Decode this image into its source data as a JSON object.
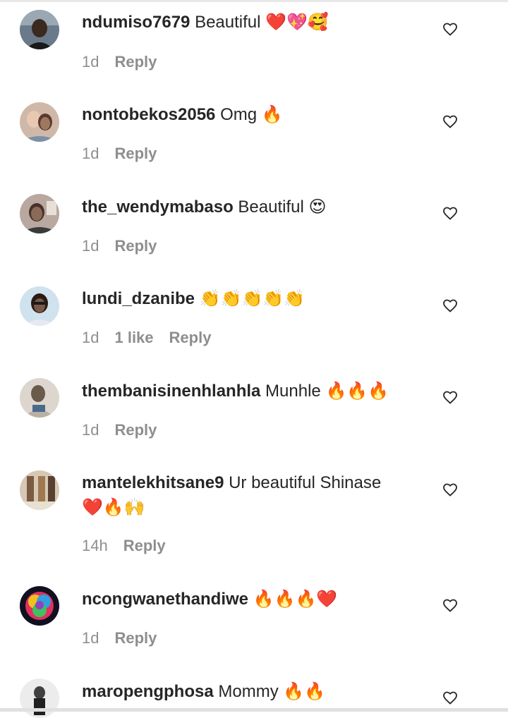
{
  "comments": [
    {
      "username": "ndumiso7679",
      "text": "Beautiful",
      "emoji": "❤️💖🥰",
      "time": "1d",
      "likes": "",
      "reply": "Reply",
      "avatar_icon": "avatar-photo",
      "avatar_colors": [
        "#5a6a7a",
        "#2a2a2a"
      ]
    },
    {
      "username": "nontobekos2056",
      "text": "Omg",
      "emoji": "🔥",
      "time": "1d",
      "likes": "",
      "reply": "Reply",
      "avatar_icon": "avatar-photo",
      "avatar_colors": [
        "#d9b8a0",
        "#3a2a2a"
      ]
    },
    {
      "username": "the_wendymabaso",
      "text": "Beautiful",
      "emoji": "😍",
      "time": "1d",
      "likes": "",
      "reply": "Reply",
      "avatar_icon": "avatar-photo",
      "avatar_colors": [
        "#c8b0a0",
        "#4a3a3a"
      ]
    },
    {
      "username": "lundi_dzanibe",
      "text": "",
      "emoji": "👏👏👏👏👏",
      "time": "1d",
      "likes": "1 like",
      "reply": "Reply",
      "avatar_icon": "avatar-photo",
      "avatar_colors": [
        "#b9d8e8",
        "#7a8a9a"
      ]
    },
    {
      "username": "thembanisinenhlanhla",
      "text": "Munhle",
      "emoji": "🔥🔥🔥",
      "time": "1d",
      "likes": "",
      "reply": "Reply",
      "avatar_icon": "avatar-photo",
      "avatar_colors": [
        "#d8d0c8",
        "#8a8070"
      ]
    },
    {
      "username": "mantelekhitsane9",
      "text": "Ur beautiful Shinase",
      "emoji": "❤️🔥🙌",
      "time": "14h",
      "likes": "",
      "reply": "Reply",
      "avatar_icon": "avatar-photo",
      "avatar_colors": [
        "#c8b8a0",
        "#6a5040"
      ]
    },
    {
      "username": "ncongwanethandiwe",
      "text": "",
      "emoji": "🔥🔥🔥❤️",
      "time": "1d",
      "likes": "",
      "reply": "Reply",
      "avatar_icon": "avatar-rose",
      "avatar_colors": [
        "#e03060",
        "#30a0e0"
      ]
    },
    {
      "username": "maropengphosa",
      "text": "Mommy",
      "emoji": "🔥🔥",
      "time": "",
      "likes": "",
      "reply": "",
      "avatar_icon": "avatar-photo",
      "avatar_colors": [
        "#e8e8e8",
        "#303030"
      ]
    }
  ],
  "icons": {
    "like": "heart-outline-icon"
  },
  "colors": {
    "text": "#262626",
    "meta": "#8e8e8e"
  }
}
